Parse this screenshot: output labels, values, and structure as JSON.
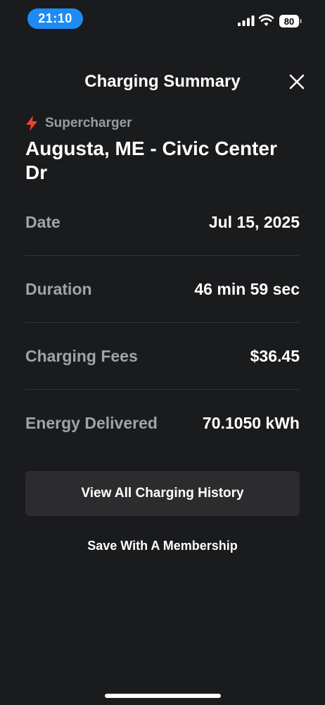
{
  "status_bar": {
    "time": "21:10",
    "battery_level": "80"
  },
  "header": {
    "title": "Charging Summary"
  },
  "location": {
    "type": "Supercharger",
    "name": "Augusta, ME - Civic Center Dr"
  },
  "details": [
    {
      "label": "Date",
      "value": "Jul 15, 2025"
    },
    {
      "label": "Duration",
      "value": "46 min 59 sec"
    },
    {
      "label": "Charging Fees",
      "value": "$36.45"
    },
    {
      "label": "Energy Delivered",
      "value": "70.1050 kWh"
    }
  ],
  "actions": {
    "history_label": "View All Charging History",
    "membership_label": "Save With A Membership"
  },
  "colors": {
    "background": "#1a1b1d",
    "accent_red": "#e8442e",
    "time_pill": "#1e8bf5",
    "button_bg": "#2c2c2e"
  }
}
